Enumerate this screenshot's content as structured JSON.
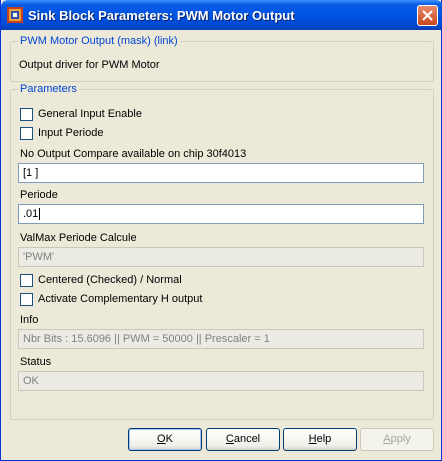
{
  "window": {
    "title": "Sink Block Parameters: PWM Motor Output"
  },
  "description": {
    "heading": "PWM Motor Output (mask) (link)",
    "text": "Output driver for PWM Motor"
  },
  "parameters": {
    "heading": "Parameters",
    "general_input_enable": {
      "label": "General Input Enable",
      "checked": false
    },
    "input_periode": {
      "label": "Input Periode",
      "checked": false
    },
    "output_compare": {
      "label": "No Output Compare available on chip 30f4013",
      "value": "[1 ]"
    },
    "periode": {
      "label": "Periode",
      "value": ".01"
    },
    "valmax": {
      "label": "ValMax Periode Calcule",
      "value": "'PWM'"
    },
    "centered": {
      "label": "Centered (Checked) / Normal",
      "checked": false
    },
    "complementary": {
      "label": "Activate Complementary H output",
      "checked": false
    },
    "info": {
      "label": "Info",
      "value": "Nbr Bits : 15.6096  ||  PWM = 50000  ||  Prescaler = 1"
    },
    "status": {
      "label": "Status",
      "value": "OK"
    }
  },
  "buttons": {
    "ok": {
      "label_first": "O",
      "label_rest": "K"
    },
    "cancel": {
      "label_first": "C",
      "label_rest": "ancel"
    },
    "help": {
      "label_first": "H",
      "label_rest": "elp"
    },
    "apply": {
      "label_first": "A",
      "label_rest": "pply",
      "enabled": false
    }
  }
}
